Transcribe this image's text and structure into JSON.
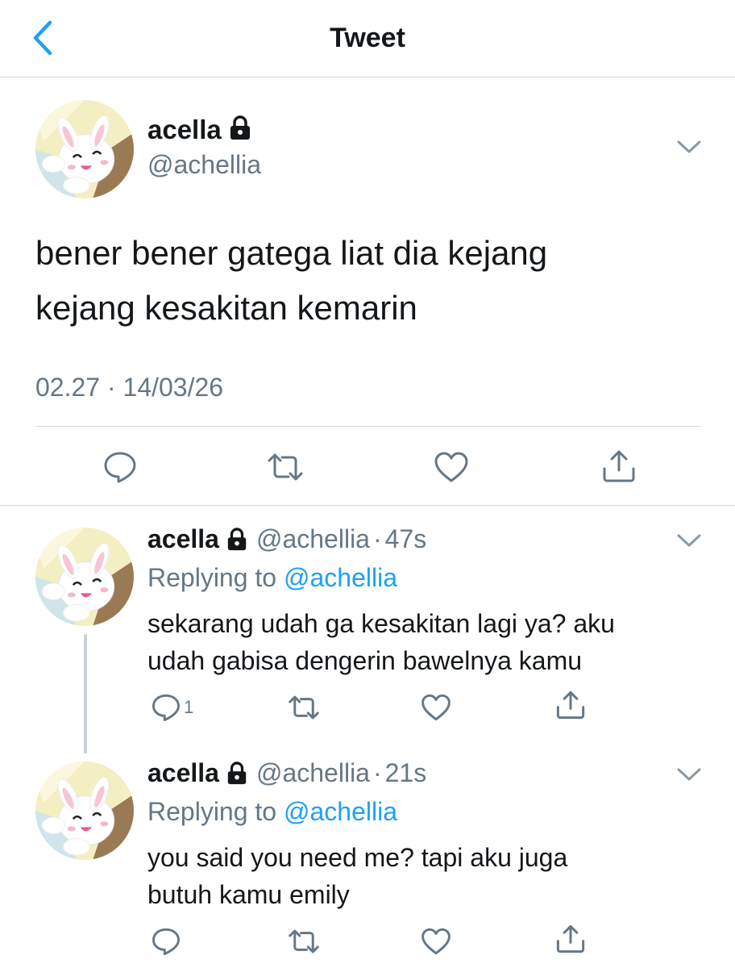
{
  "header": {
    "title": "Tweet",
    "back_icon": "chevron-left-icon"
  },
  "main_tweet": {
    "name": "acella",
    "handle": "@achellia",
    "text_line1": "bener bener gatega liat dia kejang",
    "text_line2": "kejang kesakitan kemarin",
    "timestamp": "02.27 · 14/03/26",
    "icons": {
      "lock": "lock-icon",
      "menu": "chevron-down-icon",
      "reply": "reply-icon",
      "retweet": "retweet-icon",
      "like": "heart-icon",
      "share": "share-icon"
    }
  },
  "replies": [
    {
      "name": "acella",
      "handle": "@achellia",
      "separator": "·",
      "time": "47s",
      "replying_prefix": "Replying to",
      "replying_to": "@achellia",
      "text_line1": "sekarang udah ga kesakitan lagi ya? aku",
      "text_line2": "udah gabisa dengerin bawelnya kamu",
      "reply_count": "1"
    },
    {
      "name": "acella",
      "handle": "@achellia",
      "separator": "·",
      "time": "21s",
      "replying_prefix": "Replying to",
      "replying_to": "@achellia",
      "text_line1": "you said you need me? tapi aku juga",
      "text_line2": "butuh kamu emily",
      "reply_count": ""
    }
  ],
  "colors": {
    "accent": "#1da1f2",
    "secondary_text": "#657786",
    "icon": "#657786",
    "divider": "#d3dade"
  }
}
